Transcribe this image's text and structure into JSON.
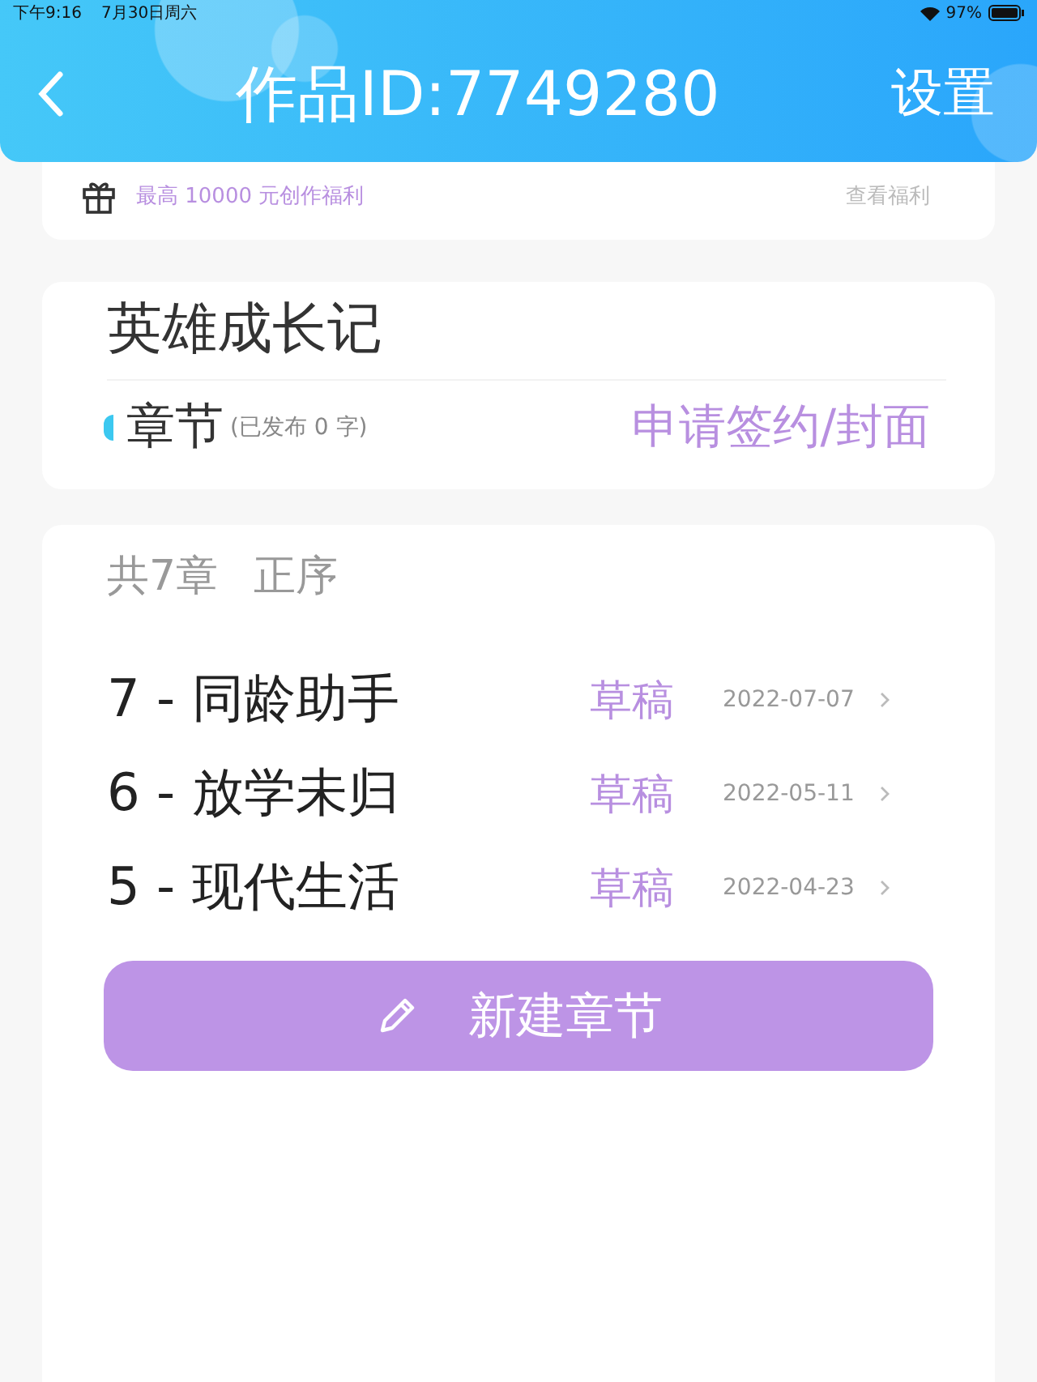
{
  "status_bar": {
    "time": "下午9:16",
    "date": "7月30日周六",
    "battery": "97%"
  },
  "header": {
    "title": "作品ID:7749280",
    "settings": "设置"
  },
  "benefit": {
    "text": "最高 10000 元创作福利",
    "link": "查看福利"
  },
  "work": {
    "name": "英雄成长记",
    "section": "章节",
    "published": "(已发布 0 字)",
    "action": "申请签约/封面"
  },
  "chapters_header": {
    "count": "共7章",
    "order": "正序"
  },
  "chapters": [
    {
      "title": "7 - 同龄助手",
      "status": "草稿",
      "date": "2022-07-07"
    },
    {
      "title": "6 - 放学未归",
      "status": "草稿",
      "date": "2022-05-11"
    },
    {
      "title": "5 - 现代生活",
      "status": "草稿",
      "date": "2022-04-23"
    }
  ],
  "new_button": "新建章节"
}
